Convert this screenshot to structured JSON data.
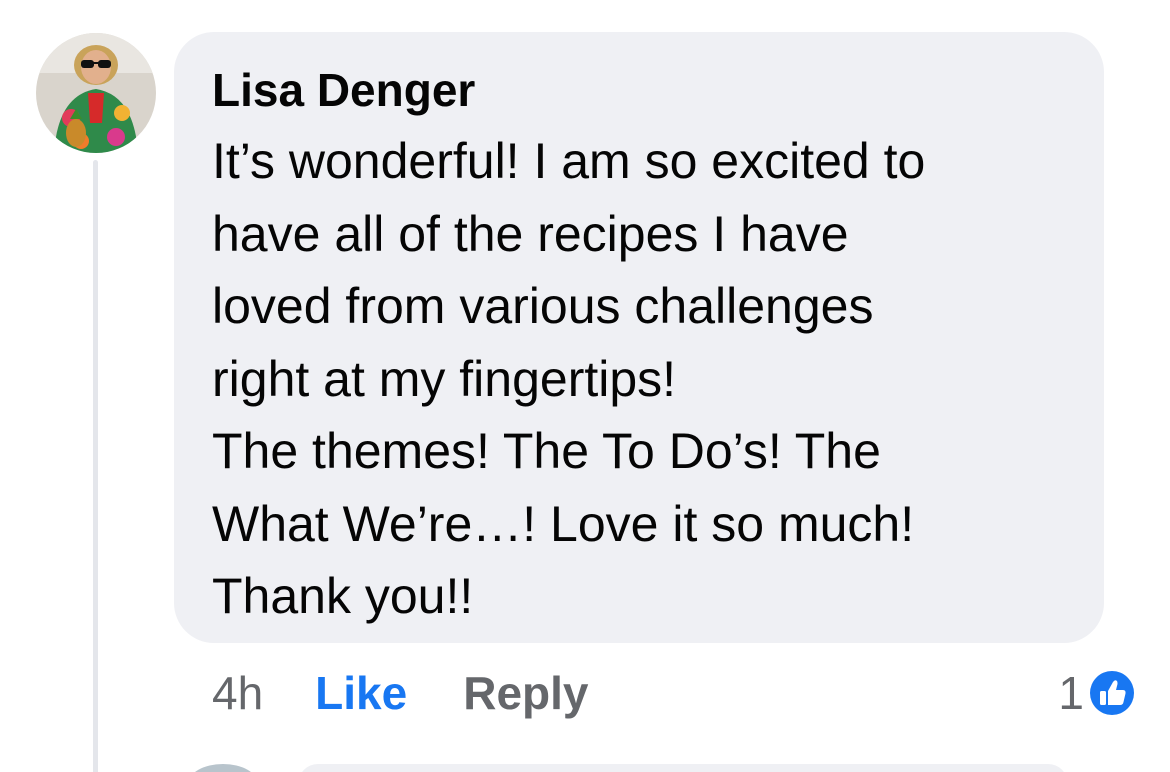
{
  "comment": {
    "author": "Lisa Denger",
    "text_lines": [
      "It’s wonderful!  I am so excited to",
      "have all of the recipes I have",
      "loved from various challenges",
      "right at my fingertips!",
      "The themes!  The To Do’s! The",
      "What We’re…!  Love it so much!",
      "Thank you!!"
    ],
    "timestamp": "4h",
    "like_label": "Like",
    "reply_label": "Reply",
    "reaction_count": "1",
    "reaction_icon": "like-thumbs-up-icon"
  },
  "colors": {
    "bubble": "#eff0f4",
    "like_blue": "#1877f2",
    "meta_gray": "#65676b",
    "text": "#050505"
  }
}
